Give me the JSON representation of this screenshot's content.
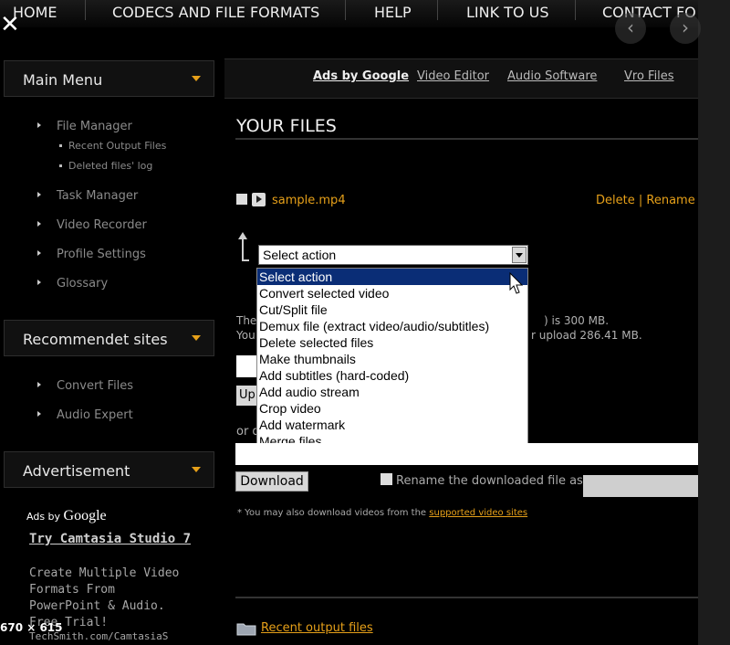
{
  "nav": {
    "items": [
      "HOME",
      "CODECS AND FILE FORMATS",
      "HELP",
      "LINK TO US",
      "CONTACT FO"
    ],
    "close_glyph": "✕",
    "prev_glyph": "‹",
    "next_glyph": "›"
  },
  "sidebar": {
    "main_menu": {
      "title": "Main Menu",
      "items": [
        "File Manager",
        "Task Manager",
        "Video Recorder",
        "Profile Settings",
        "Glossary"
      ],
      "sub_items": [
        "Recent Output Files",
        "Deleted files' log"
      ]
    },
    "recommended": {
      "title": "Recommendet sites",
      "items": [
        "Convert Files",
        "Audio Expert"
      ]
    },
    "advertisement": {
      "title": "Advertisement",
      "ads_by": "Ads by",
      "google": "Google",
      "ad_title": "Try Camtasia Studio 7",
      "ad_lines": [
        "Create Multiple Video",
        "Formats From",
        "PowerPoint & Audio.",
        "Free Trial!"
      ],
      "ad_url": "TechSmith.com/CamtasiaS"
    }
  },
  "overlay": {
    "dimensions": "670 × 615"
  },
  "topics": {
    "ads_by_google": "Ads by Google",
    "links": [
      "Video Editor",
      "Audio Software",
      "Vro Files"
    ]
  },
  "files": {
    "heading": "YOUR FILES",
    "file_name": "sample.mp4",
    "delete": "Delete",
    "sep": "|",
    "rename": "Rename"
  },
  "action_select": {
    "value": "Select action",
    "options": [
      "Select action",
      "Convert selected video",
      "Cut/Split file",
      "Demux file (extract video/audio/subtitles)",
      "Delete selected files",
      "Make thumbnails",
      "Add subtitles (hard-coded)",
      "Add audio stream",
      "Crop video",
      "Add watermark",
      "Merge files"
    ],
    "selected_index": 0
  },
  "behind": {
    "line1_start": "The",
    "line1_end": ") is 300 MB.",
    "line2_start": "You",
    "line2_end": "r upload 286.41 MB.",
    "upload_fragment": "Up",
    "or_fragment": "or d"
  },
  "download": {
    "button": "Download",
    "rename_label": "Rename the downloaded file as",
    "note": "* You may also download videos from the",
    "note_link": "supported video sites"
  },
  "footer": {
    "recent_link": "Recent output files"
  },
  "colors": {
    "accent": "#e6a019",
    "highlight": "#0a2d76"
  }
}
